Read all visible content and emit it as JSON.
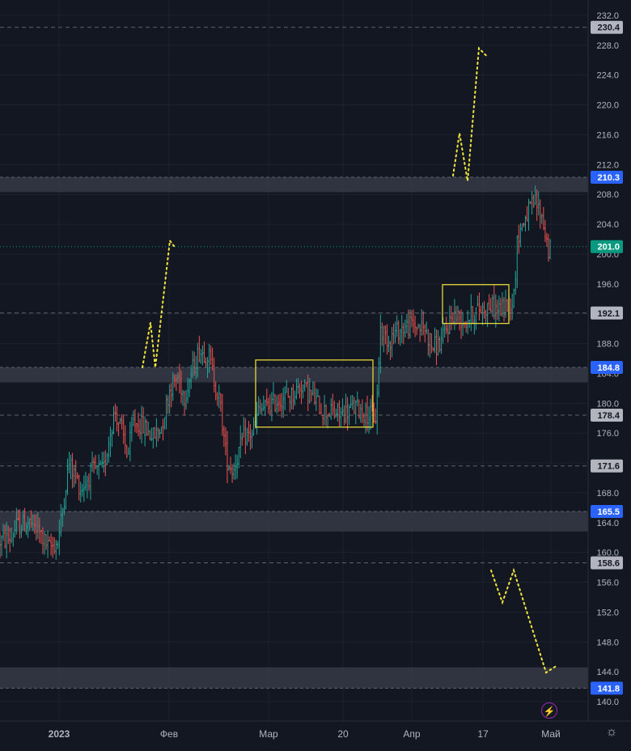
{
  "chart_data": {
    "type": "candlestick",
    "y_ticks": [
      "232.0",
      "228.0",
      "224.0",
      "220.0",
      "216.0",
      "212.0",
      "208.0",
      "204.0",
      "200.0",
      "196.0",
      "192.0",
      "188.0",
      "184.0",
      "180.0",
      "176.0",
      "172.0",
      "168.0",
      "164.0",
      "160.0",
      "156.0",
      "152.0",
      "148.0",
      "144.0",
      "140.0"
    ],
    "x_ticks": [
      "2023",
      "Фев",
      "Мар",
      "20",
      "Апр",
      "17",
      "Май"
    ],
    "ylim": [
      138.0,
      233.5
    ],
    "bar_count": 335,
    "price_path": [
      [
        0,
        161.5
      ],
      [
        14,
        162.0
      ],
      [
        20,
        163.5
      ],
      [
        37,
        164.0
      ],
      [
        50,
        162.5
      ],
      [
        60,
        160.5
      ],
      [
        72,
        161.5
      ],
      [
        85,
        172.0
      ],
      [
        92,
        170.5
      ],
      [
        100,
        168.5
      ],
      [
        115,
        171.0
      ],
      [
        128,
        171.0
      ],
      [
        135,
        175.5
      ],
      [
        142,
        179.0
      ],
      [
        150,
        176.5
      ],
      [
        158,
        173.0
      ],
      [
        165,
        177.5
      ],
      [
        175,
        177.0
      ],
      [
        190,
        175.5
      ],
      [
        200,
        177.0
      ],
      [
        210,
        182.0
      ],
      [
        220,
        183.5
      ],
      [
        228,
        181.0
      ],
      [
        238,
        184.5
      ],
      [
        246,
        187.0
      ],
      [
        258,
        186.5
      ],
      [
        266,
        182.5
      ],
      [
        272,
        180.0
      ],
      [
        280,
        172.5
      ],
      [
        288,
        171.0
      ],
      [
        295,
        173.5
      ],
      [
        302,
        175.5
      ],
      [
        312,
        176.0
      ],
      [
        320,
        179.0
      ],
      [
        330,
        179.5
      ],
      [
        345,
        180.5
      ],
      [
        360,
        181.0
      ],
      [
        372,
        182.5
      ],
      [
        385,
        181.0
      ],
      [
        400,
        179.0
      ],
      [
        420,
        178.5
      ],
      [
        440,
        179.5
      ],
      [
        455,
        178.5
      ],
      [
        465,
        178.0
      ],
      [
        470,
        190.0
      ],
      [
        480,
        188.5
      ],
      [
        495,
        190.0
      ],
      [
        510,
        190.5
      ],
      [
        525,
        190.0
      ],
      [
        535,
        187.5
      ],
      [
        545,
        188.0
      ],
      [
        552,
        190.0
      ],
      [
        560,
        192.0
      ],
      [
        575,
        191.0
      ],
      [
        590,
        192.5
      ],
      [
        605,
        193.0
      ],
      [
        620,
        192.5
      ],
      [
        635,
        194.0
      ],
      [
        640,
        202.5
      ],
      [
        652,
        205.5
      ],
      [
        662,
        207.0
      ],
      [
        670,
        205.0
      ],
      [
        678,
        200.5
      ]
    ],
    "levels": [
      {
        "label": "230.4",
        "value": 230.4,
        "style": "dashed"
      },
      {
        "label": "210.3",
        "value": 210.3,
        "style": "zone",
        "zone_low": 208.3
      },
      {
        "label": "201.0",
        "value": 201.0,
        "style": "dotted-current"
      },
      {
        "label": "192.1",
        "value": 192.1,
        "style": "dashed"
      },
      {
        "label": "184.8",
        "value": 184.8,
        "style": "zone",
        "zone_low": 182.8
      },
      {
        "label": "178.4",
        "value": 178.4,
        "style": "dashed"
      },
      {
        "label": "171.6",
        "value": 171.6,
        "style": "dashed"
      },
      {
        "label": "165.5",
        "value": 165.5,
        "style": "zone",
        "zone_low": 162.8
      },
      {
        "label": "158.6",
        "value": 158.6,
        "style": "dashed"
      },
      {
        "label": "141.8",
        "value": 141.8,
        "style": "zone",
        "zone_low": 144.6
      }
    ],
    "rectangles": [
      {
        "from": 316,
        "to": 461,
        "low": 176.8,
        "high": 185.8
      },
      {
        "from": 547,
        "to": 629,
        "low": 190.7,
        "high": 195.9
      }
    ],
    "projections": [
      [
        [
          176,
          184.8
        ],
        [
          186,
          190.8
        ],
        [
          192,
          184.8
        ],
        [
          210,
          201.8
        ],
        [
          217,
          200.8
        ]
      ],
      [
        [
          560,
          210.5
        ],
        [
          568,
          216.2
        ],
        [
          578,
          209.8
        ],
        [
          592,
          227.6
        ],
        [
          603,
          226.4
        ]
      ],
      [
        [
          607,
          157.6
        ],
        [
          621,
          153.3
        ],
        [
          635,
          157.6
        ],
        [
          675,
          143.9
        ],
        [
          688,
          144.8
        ]
      ]
    ],
    "colors": {
      "up": "#26a69a",
      "down": "#ef5350",
      "background": "#131722",
      "grid": "#1e222d",
      "axis_text": "#b2b5be",
      "zone": "#363a45",
      "annotation": "#f5e63b",
      "label_blue": "#2962ff",
      "label_green": "#089981",
      "label_gray": "#b2b5be"
    }
  },
  "ui": {
    "settings_icon": "gear-icon",
    "replay_icon": "lightning-icon"
  }
}
